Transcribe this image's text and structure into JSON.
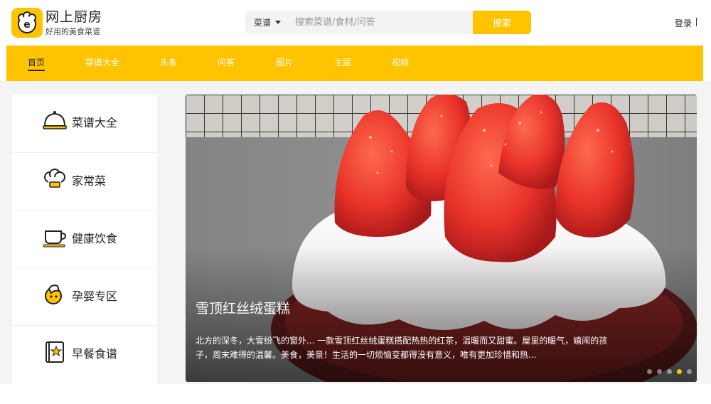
{
  "brand": {
    "title": "网上厨房",
    "subtitle": "好用的美食菜谱",
    "logo_icon": "chef-hat-e-logo-icon"
  },
  "search": {
    "type_label": "菜谱",
    "placeholder": "搜索菜谱/食材/问答",
    "button_label": "搜索"
  },
  "header": {
    "login_label": "登录"
  },
  "nav": {
    "items": [
      {
        "label": "首页",
        "active": true
      },
      {
        "label": "菜谱大全",
        "active": false
      },
      {
        "label": "头条",
        "active": false
      },
      {
        "label": "问答",
        "active": false
      },
      {
        "label": "图片",
        "active": false
      },
      {
        "label": "主题",
        "active": false
      },
      {
        "label": "视频",
        "active": false
      }
    ]
  },
  "sidebar": {
    "items": [
      {
        "label": "菜谱大全",
        "icon": "cloche-icon"
      },
      {
        "label": "家常菜",
        "icon": "chef-hat-icon"
      },
      {
        "label": "健康饮食",
        "icon": "teacup-icon"
      },
      {
        "label": "孕婴专区",
        "icon": "baby-bottle-icon"
      },
      {
        "label": "早餐食谱",
        "icon": "star-book-icon"
      }
    ]
  },
  "banner": {
    "title": "雪顶红丝绒蛋糕",
    "description": "北方的深冬，大雪纷飞的窗外... 一款雪顶红丝绒蛋糕搭配热热的红茶，温暖而又甜蜜。屋里的暖气，嬉闹的孩子，周末难得的温馨。美食，美景！生活的一切烦恼变都得没有意义，唯有更加珍惜和热...",
    "slide_count": 5,
    "active_slide": 4
  },
  "colors": {
    "accent": "#ffc300",
    "nav_text": "#ffffff",
    "nav_active_text": "#222222"
  }
}
